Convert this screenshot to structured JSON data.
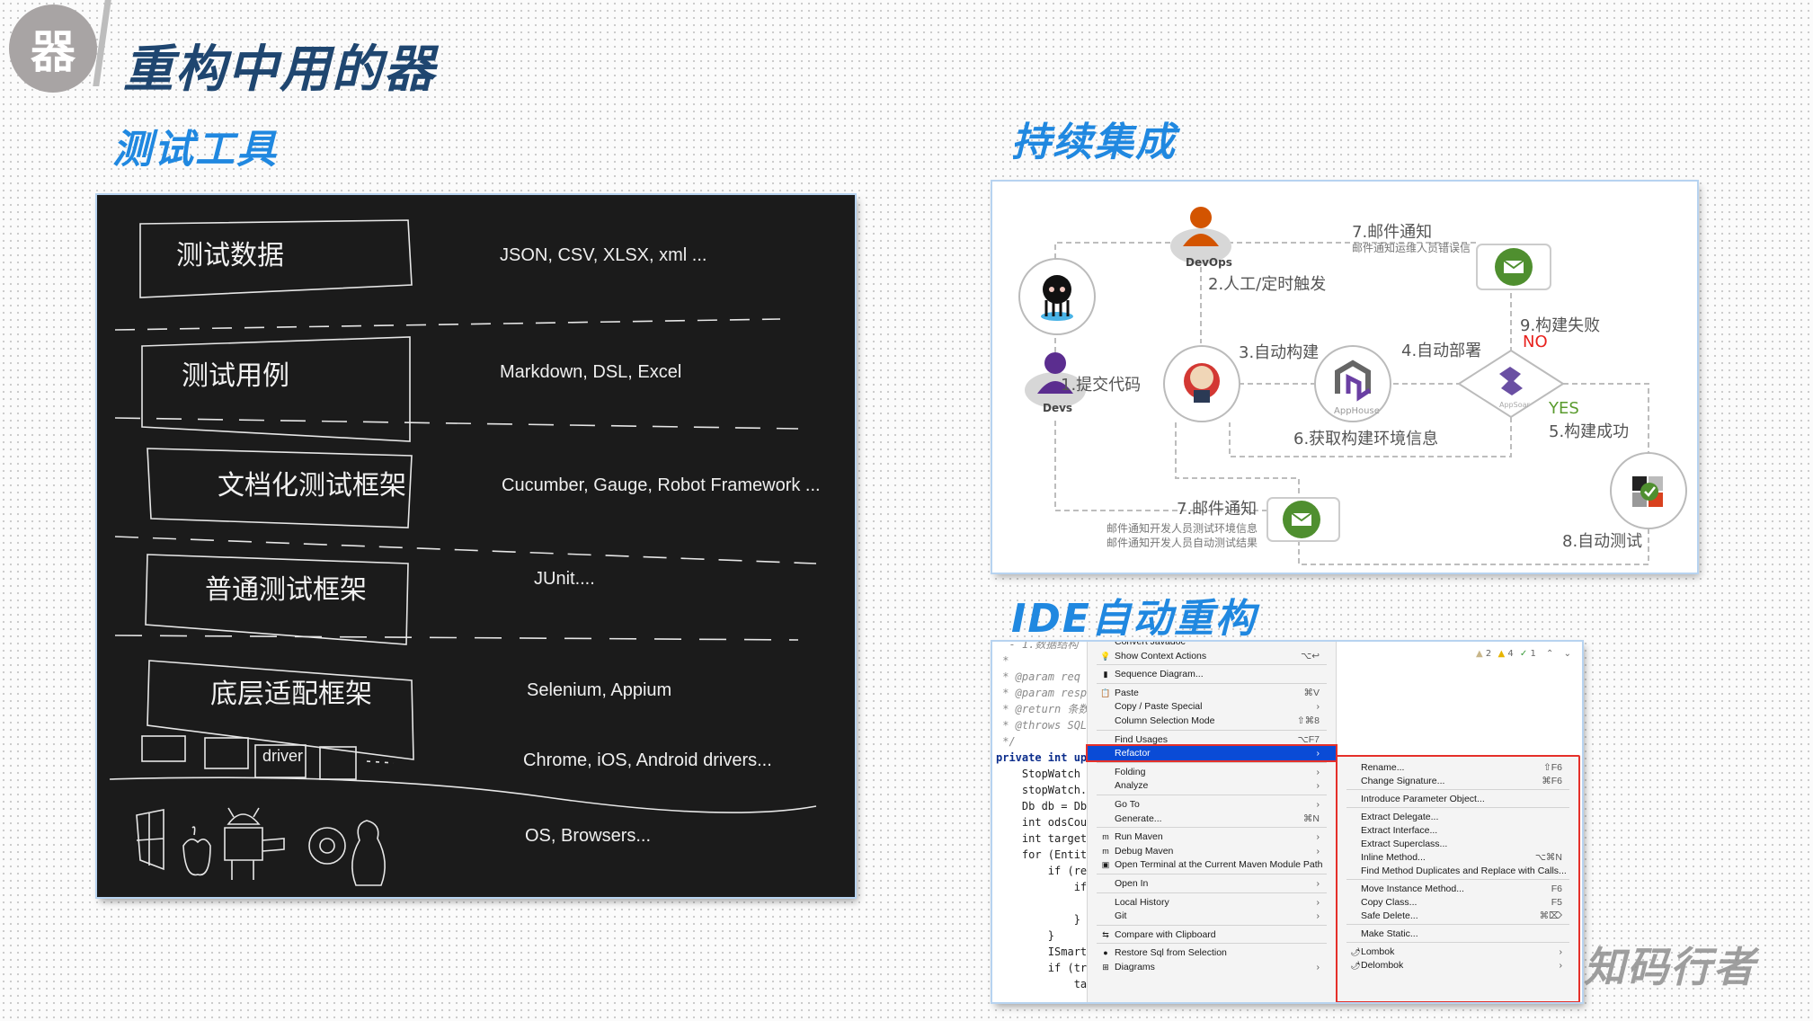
{
  "header": {
    "badge_char": "器",
    "title": "重构中用的器"
  },
  "sections": {
    "testing_tools": "测试工具",
    "ci": "持续集成",
    "ide": "IDE自动重构"
  },
  "testing_layers": [
    {
      "label": "测试数据",
      "examples": "JSON, CSV, XLSX, xml ..."
    },
    {
      "label": "测试用例",
      "examples": "Markdown, DSL, Excel"
    },
    {
      "label": "文档化测试框架",
      "examples": "Cucumber, Gauge, Robot Framework ..."
    },
    {
      "label": "普通测试框架",
      "examples": "JUnit...."
    },
    {
      "label": "底层适配框架",
      "examples": "Selenium, Appium"
    },
    {
      "label": "driver",
      "examples": "Chrome, iOS, Android drivers..."
    },
    {
      "label": "",
      "examples": "OS, Browsers..."
    }
  ],
  "os_icons": [
    "windows-icon",
    "apple-icon",
    "android-icon",
    "chrome-icon",
    "linux-icon"
  ],
  "ci_diagram": {
    "nodes": {
      "devops": "DevOps",
      "devs": "Devs",
      "apphouse": "AppHouse",
      "appsoar": "AppSoar"
    },
    "steps": {
      "s1": "1.提交代码",
      "s2": "2.人工/定时触发",
      "s3": "3.自动构建",
      "s4": "4.自动部署",
      "s5": "5.构建成功",
      "s6": "6.获取构建环境信息",
      "s7_top": "7.邮件通知",
      "s7_top_sub": "邮件通知运维人员错误信",
      "s7_bottom": "7.邮件通知",
      "s7_bottom_sub1": "邮件通知开发人员测试环境信息",
      "s7_bottom_sub2": "邮件通知开发人员自动测试结果",
      "s8": "8.自动测试",
      "s9": "9.构建失败",
      "no": "NO",
      "yes": "YES"
    },
    "colors": {
      "no": "#e8211d",
      "yes": "#5a9b2e",
      "mail": "#4f8f2f",
      "devops": "#d35400",
      "devs": "#5b2d8f"
    }
  },
  "ide": {
    "code_lines": [
      {
        "t": "  - 1.数据结构",
        "cls": "doc"
      },
      {
        "t": " *",
        "cls": "doc"
      },
      {
        "t": " * @param req 接",
        "cls": "doc"
      },
      {
        "t": " * @param respD",
        "cls": "doc"
      },
      {
        "t": " * @return 条数",
        "cls": "doc"
      },
      {
        "t": " * @throws SQLE",
        "cls": "doc"
      },
      {
        "t": " */",
        "cls": "doc"
      },
      {
        "t": "private int ups",
        "cls": "kw"
      },
      {
        "t": "    StopWatch s",
        "cls": ""
      },
      {
        "t": "    stopWatch.s",
        "cls": ""
      },
      {
        "t": "    Db db = DbU",
        "cls": ""
      },
      {
        "t": "    int odsCoun",
        "cls": ""
      },
      {
        "t": "    int targetC",
        "cls": ""
      },
      {
        "t": "    for (Entity",
        "cls": ""
      },
      {
        "t": "        if (req",
        "cls": ""
      },
      {
        "t": "            if",
        "cls": ""
      },
      {
        "t": "",
        "cls": ""
      },
      {
        "t": "            }",
        "cls": ""
      },
      {
        "t": "        }",
        "cls": ""
      },
      {
        "t": "        ISmartE",
        "cls": ""
      },
      {
        "t": "        if (tra",
        "cls": ""
      },
      {
        "t": "            tar",
        "cls": ""
      }
    ],
    "inspection": {
      "weak_warnings": "2",
      "warnings": "4",
      "typos": "1"
    },
    "context_menu": [
      {
        "label": "Convert Javadoc",
        "shortcut": "",
        "icon": "",
        "partial": true
      },
      {
        "label": "Show Context Actions",
        "shortcut": "⌥↩",
        "icon": "bulb-icon"
      },
      {
        "sep": true
      },
      {
        "label": "Sequence Diagram...",
        "shortcut": "",
        "icon": "sequence-diagram-icon"
      },
      {
        "sep": true
      },
      {
        "label": "Paste",
        "shortcut": "⌘V",
        "icon": "clipboard-icon"
      },
      {
        "label": "Copy / Paste Special",
        "shortcut": "›",
        "icon": ""
      },
      {
        "label": "Column Selection Mode",
        "shortcut": "⇧⌘8",
        "icon": ""
      },
      {
        "sep": true
      },
      {
        "label": "Find Usages",
        "shortcut": "⌥F7",
        "icon": ""
      },
      {
        "label": "Refactor",
        "shortcut": "›",
        "icon": "",
        "selected": true
      },
      {
        "sep": true
      },
      {
        "label": "Folding",
        "shortcut": "›",
        "icon": ""
      },
      {
        "label": "Analyze",
        "shortcut": "›",
        "icon": ""
      },
      {
        "sep": true
      },
      {
        "label": "Go To",
        "shortcut": "›",
        "icon": ""
      },
      {
        "label": "Generate...",
        "shortcut": "⌘N",
        "icon": ""
      },
      {
        "sep": true
      },
      {
        "label": "Run Maven",
        "shortcut": "›",
        "icon": "maven-run-icon"
      },
      {
        "label": "Debug Maven",
        "shortcut": "›",
        "icon": "maven-debug-icon"
      },
      {
        "label": "Open Terminal at the Current Maven Module Path",
        "shortcut": "",
        "icon": "terminal-icon"
      },
      {
        "sep": true
      },
      {
        "label": "Open In",
        "shortcut": "›",
        "icon": ""
      },
      {
        "sep": true
      },
      {
        "label": "Local History",
        "shortcut": "›",
        "icon": ""
      },
      {
        "label": "Git",
        "shortcut": "›",
        "icon": ""
      },
      {
        "sep": true
      },
      {
        "label": "Compare with Clipboard",
        "shortcut": "",
        "icon": "compare-icon"
      },
      {
        "sep": true
      },
      {
        "label": "Restore Sql from Selection",
        "shortcut": "",
        "icon": "mybatis-icon"
      },
      {
        "label": "Diagrams",
        "shortcut": "›",
        "icon": "diagram-icon",
        "partial": true
      }
    ],
    "refactor_submenu": [
      {
        "label": "Rename...",
        "shortcut": "⇧F6"
      },
      {
        "label": "Change Signature...",
        "shortcut": "⌘F6"
      },
      {
        "sep": true
      },
      {
        "label": "Introduce Parameter Object...",
        "shortcut": ""
      },
      {
        "sep": true
      },
      {
        "label": "Extract Delegate...",
        "shortcut": ""
      },
      {
        "label": "Extract Interface...",
        "shortcut": ""
      },
      {
        "label": "Extract Superclass...",
        "shortcut": ""
      },
      {
        "label": "Inline Method...",
        "shortcut": "⌥⌘N"
      },
      {
        "label": "Find Method Duplicates and Replace with Calls...",
        "shortcut": ""
      },
      {
        "sep": true
      },
      {
        "label": "Move Instance Method...",
        "shortcut": "F6"
      },
      {
        "label": "Copy Class...",
        "shortcut": "F5"
      },
      {
        "label": "Safe Delete...",
        "shortcut": "⌘⌦"
      },
      {
        "sep": true
      },
      {
        "label": "Make Static...",
        "shortcut": ""
      },
      {
        "sep": true
      },
      {
        "label": "Lombok",
        "shortcut": "›",
        "icon": "chili-pepper-icon"
      },
      {
        "label": "Delombok",
        "shortcut": "›",
        "icon": "chili-pepper-icon"
      }
    ]
  },
  "watermark": "知码行者"
}
